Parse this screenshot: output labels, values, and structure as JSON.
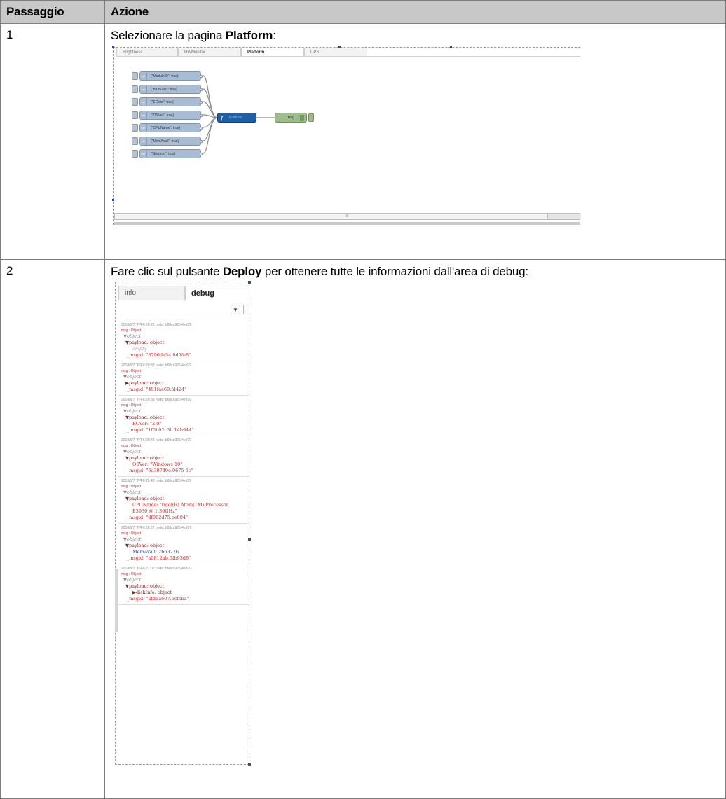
{
  "table": {
    "header_step": "Passaggio",
    "header_action": "Azione"
  },
  "rows": [
    {
      "step": "1",
      "text_before": "Selezionare la pagina ",
      "text_bold": "Platform",
      "text_after": ":"
    },
    {
      "step": "2",
      "text_before": "Fare clic sul pulsante ",
      "text_bold": "Deploy",
      "text_after": " per ottenere tutte le informazioni dall'area di debug:"
    }
  ],
  "flow_screenshot": {
    "tabs": [
      "Brightness",
      "HWMonitor",
      "Platform",
      "UPS"
    ],
    "active_tab": "Platform",
    "inject_nodes": [
      "{\"ModuleID\": true}",
      "{\"BIOSVer\": true}",
      "{\"ECVer\": true}",
      "{\"OSVer\": true}",
      "{\"CPUName\": true}",
      "{\"MemAvail\": true}",
      "{\"diskInfo\": true}"
    ],
    "function_node": "Platform",
    "debug_node": "msg"
  },
  "debug_screenshot": {
    "tabs": [
      "info",
      "debug"
    ],
    "active_tab": "debug",
    "filter_icon": "filter-icon",
    "messages": [
      {
        "meta": "2018/5/7 下午6:20:28   node: b60ca926.4ed79",
        "type": "msg : Object",
        "lines": [
          {
            "text": "▼object",
            "cls": "s2-obj ind1"
          },
          {
            "text": "▼payload: object",
            "cls": "s2-key ind2"
          },
          {
            "text": "empty",
            "cls": "s2-empty ind3"
          },
          {
            "text": "_msgid: \"8796da34.0d5fe8\"",
            "cls": "s2-str ind4"
          }
        ]
      },
      {
        "meta": "2018/5/7 下午6:20:33   node: b60ca926.4ed79",
        "type": "msg : Object",
        "lines": [
          {
            "text": "▼object",
            "cls": "s2-obj ind1"
          },
          {
            "text": "▶payload: object",
            "cls": "s2-key ind2"
          },
          {
            "text": "_msgid: \"491fae69.fd424\"",
            "cls": "s2-str ind4"
          }
        ]
      },
      {
        "meta": "2018/5/7 下午6:20:39   node: b60ca926.4ed79",
        "type": "msg : Object",
        "lines": [
          {
            "text": "▼object",
            "cls": "s2-obj ind1"
          },
          {
            "text": "▼payload: object",
            "cls": "s2-key ind2"
          },
          {
            "text": "ECVer: \"2.0\"",
            "cls": "s2-str ind3"
          },
          {
            "text": "_msgid: \"1f5b02c3b.14b944\"",
            "cls": "s2-str ind4"
          }
        ]
      },
      {
        "meta": "2018/5/7 下午6:20:43   node: b60ca926.4ed79",
        "type": "msg : Object",
        "lines": [
          {
            "text": "▼object",
            "cls": "s2-obj ind1"
          },
          {
            "text": "▼payload: object",
            "cls": "s2-key ind2"
          },
          {
            "text": "OSVer: \"Windows 10\"",
            "cls": "s2-str ind3"
          },
          {
            "text": "_msgid: \"6e39749e.0675 6c\"",
            "cls": "s2-str ind4"
          }
        ]
      },
      {
        "meta": "2018/5/7 下午6:20:48   node: b60ca926.4ed79",
        "type": "msg : Object",
        "lines": [
          {
            "text": "▼object",
            "cls": "s2-obj ind1"
          },
          {
            "text": "▼payload: object",
            "cls": "s2-key ind2"
          },
          {
            "text": "CPUName: \"Intel(R) Atom(TM) Processor",
            "cls": "s2-str ind3"
          },
          {
            "text": "E3930 @ 1.30GHz\"",
            "cls": "s2-str ind3"
          },
          {
            "text": "_msgid: \"df982d75.ee004\"",
            "cls": "s2-str ind4"
          }
        ]
      },
      {
        "meta": "2018/5/7 下午6:20:57   node: b60ca926.4ed79",
        "type": "msg : Object",
        "lines": [
          {
            "text": "▼object",
            "cls": "s2-obj ind1"
          },
          {
            "text": "▼payload: object",
            "cls": "s2-key ind2"
          },
          {
            "text": "MemAvail: 2663276",
            "cls": "s2-num ind3"
          },
          {
            "text": "_msgid: \"a0812ab.5fb93d8\"",
            "cls": "s2-str ind4"
          }
        ]
      },
      {
        "meta": "2018/5/7 下午6:21:02   node: b60ca926.4ed79",
        "type": "msg : Object",
        "lines": [
          {
            "text": "▼object",
            "cls": "s2-obj ind1"
          },
          {
            "text": "▼payload: object",
            "cls": "s2-key ind2"
          },
          {
            "text": "▶diskInfo: object",
            "cls": "s2-key ind3"
          },
          {
            "text": "_msgid: \"2fdda607.5cfcba\"",
            "cls": "s2-str ind4"
          }
        ]
      }
    ]
  }
}
